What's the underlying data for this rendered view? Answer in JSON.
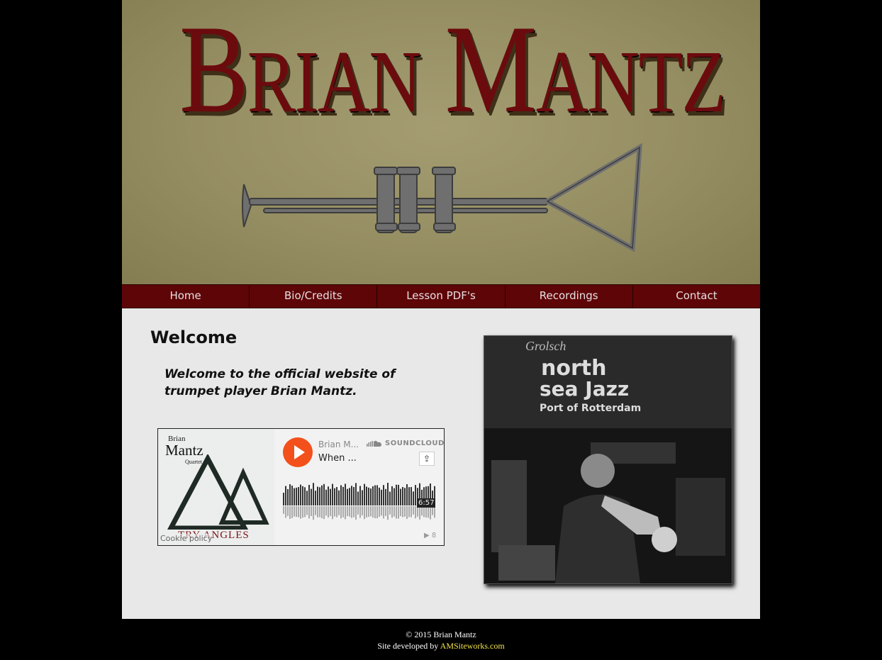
{
  "site": {
    "title": "Brian Mantz"
  },
  "nav": {
    "items": [
      {
        "label": "Home"
      },
      {
        "label": "Bio/Credits"
      },
      {
        "label": "Lesson PDF's"
      },
      {
        "label": "Recordings"
      },
      {
        "label": "Contact"
      }
    ]
  },
  "main": {
    "heading": "Welcome",
    "intro": "Welcome to the official website of trumpet player Brian Mantz."
  },
  "player": {
    "artwork": {
      "line1": "Brian",
      "line2": "Mantz",
      "line3": "Quartet",
      "album": "TRY ANGLES"
    },
    "cookie_label": "Cookie policy",
    "artist": "Brian M...",
    "track": "When ...",
    "brand": "SOUNDCLOUD",
    "duration": "6:57",
    "plays": "8",
    "play_icon": "play-icon",
    "share_icon": "share-icon",
    "accent": "#f3501b"
  },
  "photo": {
    "sign_line1": "Grolsch",
    "sign_line2": "north",
    "sign_line3": "sea Jazz",
    "sign_line4": "Port of Rotterdam"
  },
  "footer": {
    "copyright": "© 2015 Brian Mantz",
    "credit_prefix": "Site developed by",
    "credit_link": "AMSiteworks.com"
  },
  "colors": {
    "nav": "#5e0508",
    "title": "#6b0b0e",
    "link": "#f2e34a"
  }
}
